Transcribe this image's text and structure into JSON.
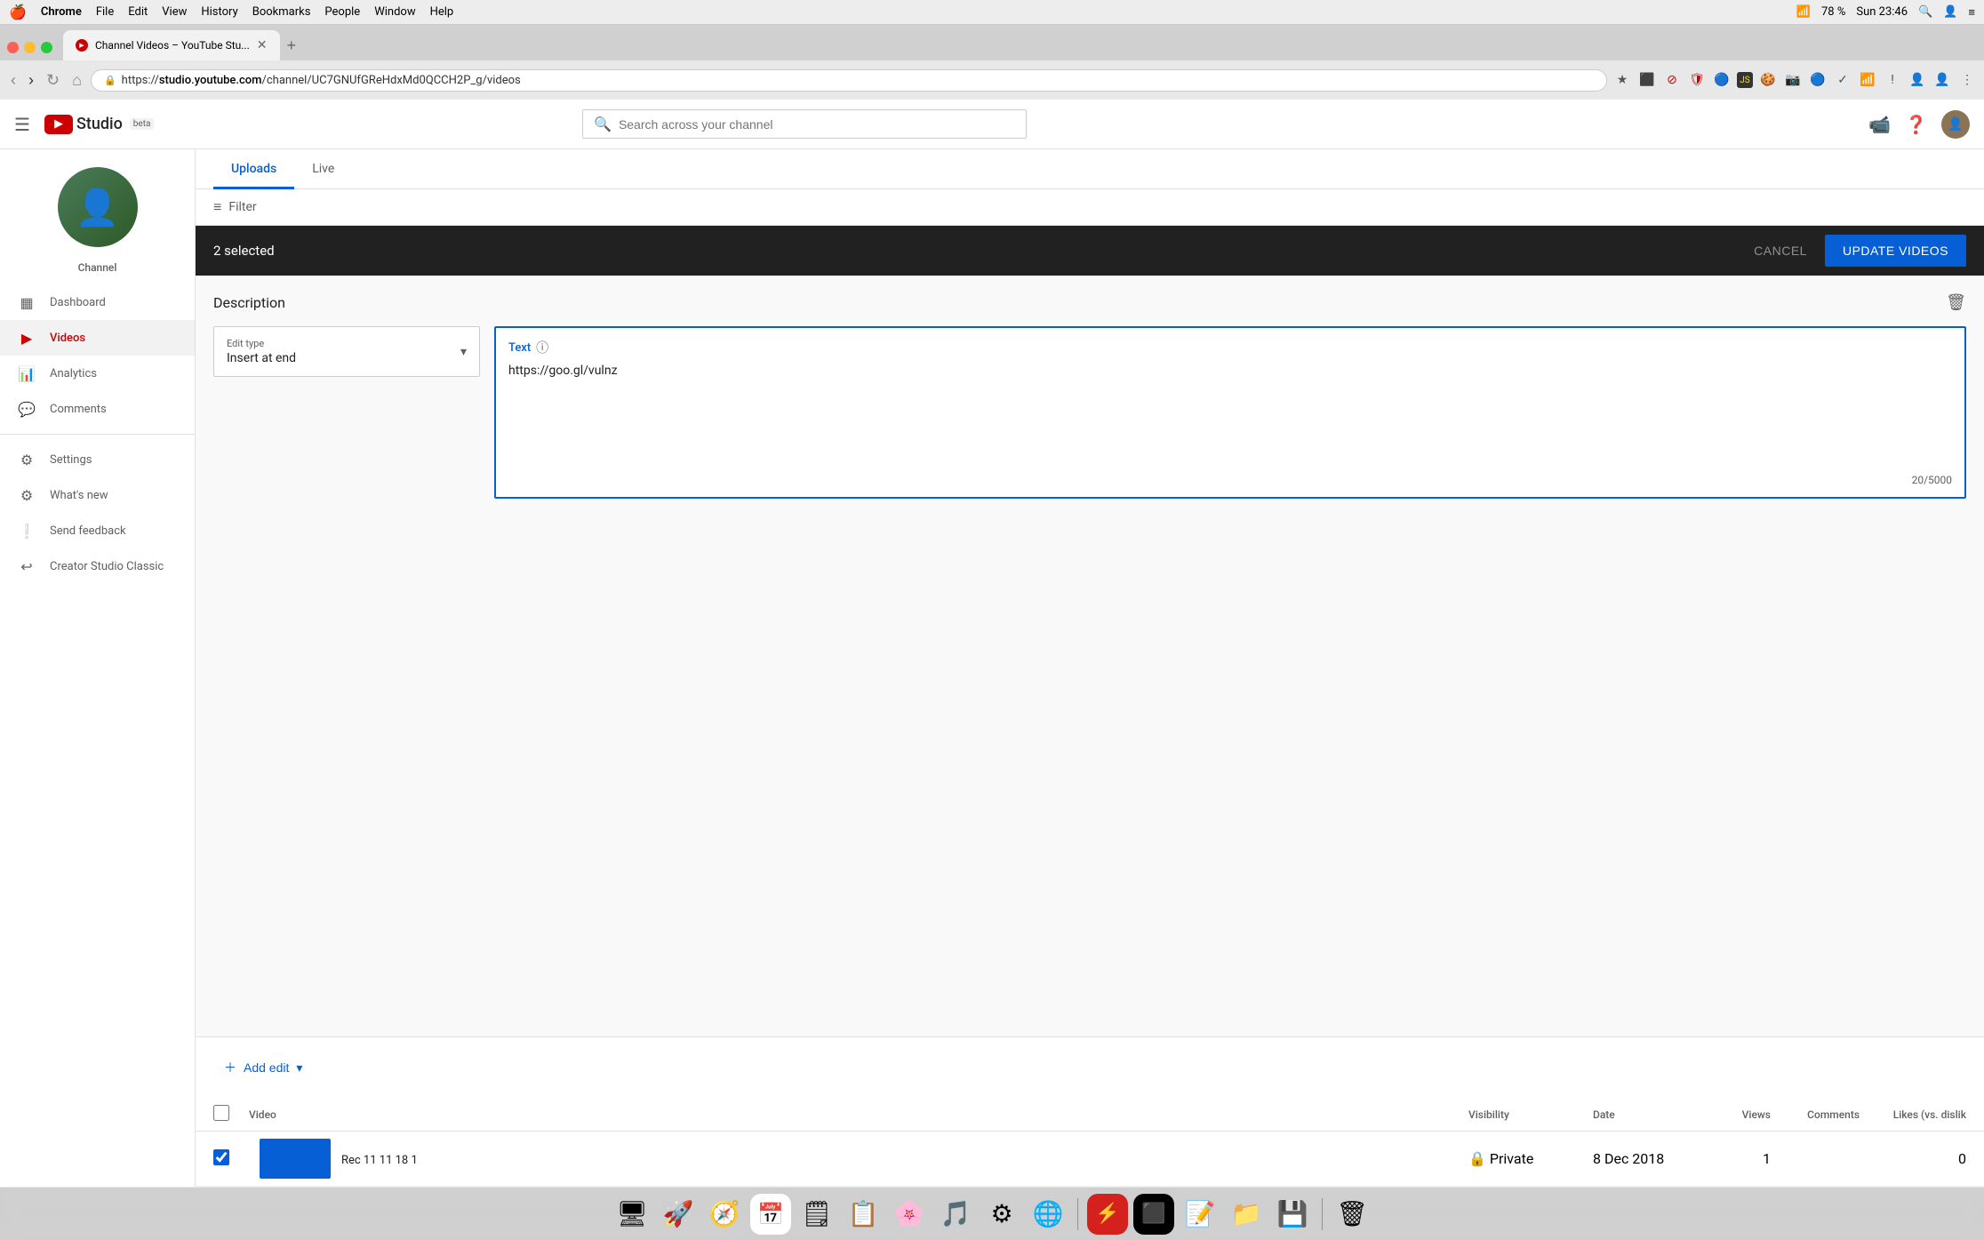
{
  "macOS": {
    "menubar": {
      "apple": "🍎",
      "appName": "Chrome",
      "menus": [
        "File",
        "Edit",
        "View",
        "History",
        "Bookmarks",
        "People",
        "Window",
        "Help"
      ],
      "time": "Sun 23:46",
      "battery": "78 %",
      "wifi": "WiFi"
    }
  },
  "browser": {
    "tab": {
      "title": "Channel Videos – YouTube Stu...",
      "favicon": "YT"
    },
    "addressBar": {
      "url": "https://studio.youtube.com/channel/UC7GNUfGReHdxMd0QCCH2P_g/videos",
      "protocol": "https://",
      "host": "studio.youtube.com",
      "path": "/channel/UC7GNUfGReHdxMd0QCCH2P_g/videos"
    }
  },
  "header": {
    "searchPlaceholder": "Search across your channel",
    "logoText": "Studio",
    "betaLabel": "beta"
  },
  "sidebar": {
    "channelLabel": "Channel",
    "items": [
      {
        "id": "dashboard",
        "label": "Dashboard",
        "icon": "▦"
      },
      {
        "id": "videos",
        "label": "Videos",
        "icon": "▶",
        "active": true
      },
      {
        "id": "analytics",
        "label": "Analytics",
        "icon": "📊"
      },
      {
        "id": "comments",
        "label": "Comments",
        "icon": "≡"
      },
      {
        "id": "settings",
        "label": "Settings",
        "icon": "⚙"
      },
      {
        "id": "whats-new",
        "label": "What's new",
        "icon": "⚙"
      },
      {
        "id": "send-feedback",
        "label": "Send feedback",
        "icon": "!"
      },
      {
        "id": "creator-studio",
        "label": "Creator Studio Classic",
        "icon": "↩"
      }
    ]
  },
  "tabs": [
    {
      "id": "uploads",
      "label": "Uploads",
      "active": true
    },
    {
      "id": "live",
      "label": "Live",
      "active": false
    }
  ],
  "filter": {
    "label": "Filter"
  },
  "selectionBar": {
    "selectedCount": "2 selected",
    "cancelLabel": "CANCEL",
    "updateLabel": "UPDATE VIDEOS"
  },
  "description": {
    "sectionTitle": "Description",
    "editType": {
      "label": "Edit type",
      "value": "Insert at end"
    },
    "textField": {
      "label": "Text",
      "value": "https://goo.gl/vulnz",
      "charCount": "20/5000"
    }
  },
  "addEdit": {
    "label": "Add edit"
  },
  "table": {
    "headers": {
      "video": "Video",
      "visibility": "Visibility",
      "date": "Date",
      "views": "Views",
      "comments": "Comments",
      "likes": "Likes (vs. dislik"
    },
    "rows": [
      {
        "checked": true,
        "title": "Rec 11 11 18 1",
        "visibility": "Private",
        "date": "8 Dec 2018",
        "views": "1",
        "comments": "",
        "likes": "0"
      }
    ]
  },
  "dock": {
    "icons": [
      {
        "id": "finder",
        "emoji": "🖥",
        "label": "Finder"
      },
      {
        "id": "launchpad",
        "emoji": "🚀",
        "label": "Launchpad"
      },
      {
        "id": "safari",
        "emoji": "🧭",
        "label": "Safari"
      },
      {
        "id": "calendar",
        "emoji": "📅",
        "label": "Calendar"
      },
      {
        "id": "notes",
        "emoji": "🗒",
        "label": "Notes"
      },
      {
        "id": "reminders",
        "emoji": "📋",
        "label": "Reminders"
      },
      {
        "id": "photos",
        "emoji": "🌸",
        "label": "Photos"
      },
      {
        "id": "music",
        "emoji": "🎵",
        "label": "Music"
      },
      {
        "id": "systemprefs",
        "emoji": "⚙",
        "label": "System Preferences"
      },
      {
        "id": "chrome",
        "emoji": "🌐",
        "label": "Chrome"
      },
      {
        "id": "thebolt",
        "emoji": "⚡",
        "label": "Bolt"
      },
      {
        "id": "terminal",
        "emoji": "⬛",
        "label": "Terminal"
      },
      {
        "id": "stickies",
        "emoji": "📝",
        "label": "Stickies"
      },
      {
        "id": "filezilla",
        "emoji": "📁",
        "label": "FileZilla"
      },
      {
        "id": "diskutil",
        "emoji": "💾",
        "label": "Disk Utility"
      },
      {
        "id": "trash",
        "emoji": "🗑",
        "label": "Trash"
      }
    ]
  }
}
